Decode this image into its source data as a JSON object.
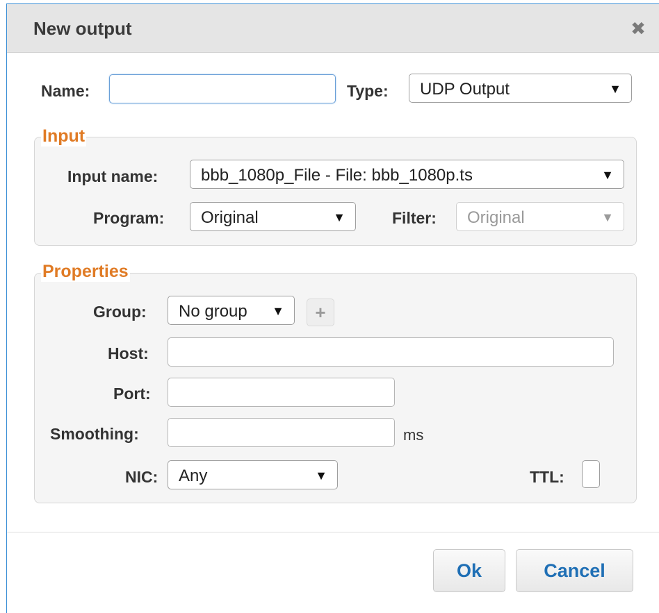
{
  "dialog": {
    "title": "New output",
    "close_icon": "close-x-icon"
  },
  "top": {
    "name_label": "Name:",
    "name_value": "",
    "type_label": "Type:",
    "type_value": "UDP Output"
  },
  "input_section": {
    "legend": "Input",
    "input_name_label": "Input name:",
    "input_name_value": "bbb_1080p_File - File: bbb_1080p.ts",
    "program_label": "Program:",
    "program_value": "Original",
    "filter_label": "Filter:",
    "filter_value": "Original"
  },
  "properties": {
    "legend": "Properties",
    "group_label": "Group:",
    "group_value": "No group",
    "add_group_icon": "plus-icon",
    "host_label": "Host:",
    "host_value": "",
    "port_label": "Port:",
    "port_value": "",
    "smoothing_label": "Smoothing:",
    "smoothing_value": "",
    "smoothing_unit": "ms",
    "nic_label": "NIC:",
    "nic_value": "Any",
    "ttl_label": "TTL:",
    "ttl_value": ""
  },
  "footer": {
    "ok_label": "Ok",
    "cancel_label": "Cancel"
  },
  "colors": {
    "accent_orange": "#e07b25",
    "button_text_blue": "#1f6fb5",
    "dialog_border_blue": "#3b8fd6"
  },
  "caret_glyph": "▼"
}
